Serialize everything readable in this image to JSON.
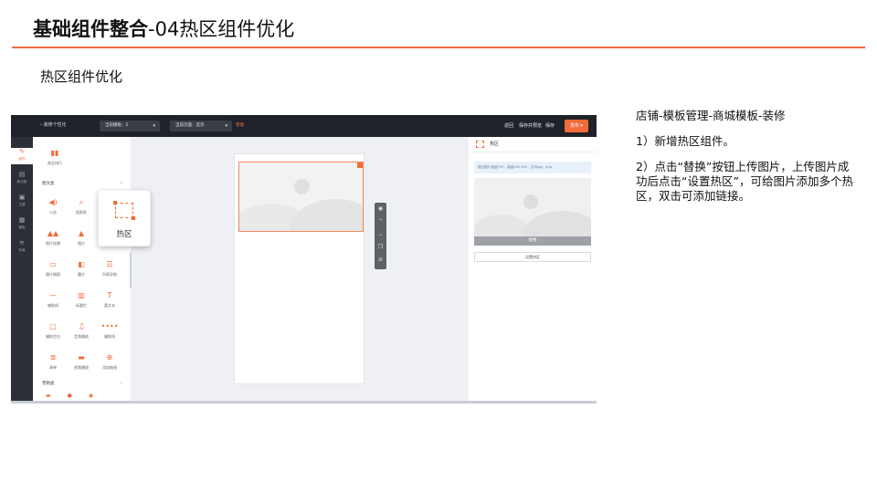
{
  "slide": {
    "title_bold": "基础组件整合",
    "title_rest": "-04热区组件优化",
    "subtitle": "热区组件优化",
    "accent_color": "#f26b3a"
  },
  "notes": {
    "path": "店铺-模板管理-商城模板-装修",
    "step1": "1）新增热区组件。",
    "step2": "2）点击“替换”按钮上传图片，上传图片成功后点击“设置热区”，可给图片添加多个热区，双击可添加链接。"
  },
  "screenshot": {
    "topbar": {
      "back": "‹ 装修个性化",
      "template_select": "当前模板：2",
      "page_select": "当前页面：首页",
      "manage_link": "管理",
      "links": [
        "返回",
        "保存并预览",
        "保存"
      ],
      "publish": "发布 ▾"
    },
    "rail": [
      {
        "icon": "brush-icon",
        "label": "组件"
      },
      {
        "icon": "page-icon",
        "label": "新页面"
      },
      {
        "icon": "store-icon",
        "label": "主题"
      },
      {
        "icon": "grid-icon",
        "label": "模板"
      },
      {
        "icon": "signal-icon",
        "label": "布局"
      }
    ],
    "components": {
      "top_item": "商品排行",
      "section1": "图文类",
      "items": [
        {
          "icon": "speaker-icon",
          "label": "公告"
        },
        {
          "icon": "search-icon",
          "label": "搜索框"
        },
        {
          "icon": "image-nav-icon",
          "label": "图片轮播"
        },
        {
          "icon": "picture-icon",
          "label": "图片"
        },
        {
          "icon": "image-window-icon",
          "label": "图片橱窗"
        },
        {
          "icon": "card-icon",
          "label": "魔方"
        },
        {
          "icon": "list-icon",
          "label": "列表导航"
        },
        {
          "icon": "divider-icon",
          "label": "辅助线"
        },
        {
          "icon": "title-icon",
          "label": "标题栏"
        },
        {
          "icon": "text-icon",
          "label": "富文本"
        },
        {
          "icon": "blank-icon",
          "label": "辅助空白"
        },
        {
          "icon": "music-icon",
          "label": "音频播放"
        },
        {
          "icon": "dots-icon",
          "label": "辅助线"
        },
        {
          "icon": "table-icon",
          "label": "表单"
        },
        {
          "icon": "video-icon",
          "label": "视频播放"
        },
        {
          "icon": "plus-icon",
          "label": "添加链接"
        }
      ],
      "section2": "营销类",
      "callout_label": "热区"
    },
    "settings": {
      "title": "热区",
      "tip": "建议图片宽度750，高度200-950，支持jpg、png。",
      "replace": "替换",
      "set_hotzone": "设置热区"
    }
  }
}
